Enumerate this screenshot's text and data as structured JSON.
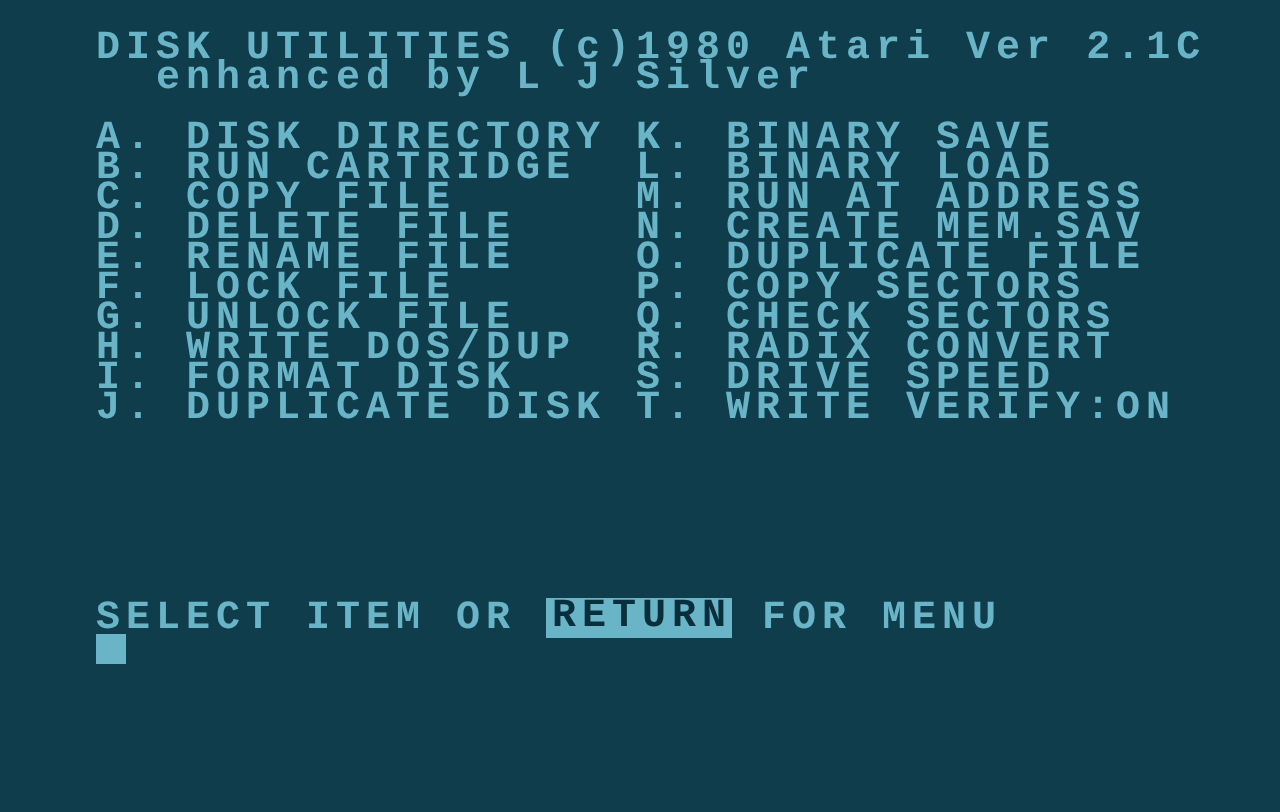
{
  "header": [
    "DISK UTILITIES (c)1980 Atari Ver 2.1C",
    "  enhanced by L J Silver"
  ],
  "menu_left": [
    "A. DISK DIRECTORY",
    "B. RUN CARTRIDGE",
    "C. COPY FILE",
    "D. DELETE FILE",
    "E. RENAME FILE",
    "F. LOCK FILE",
    "G. UNLOCK FILE",
    "H. WRITE DOS/DUP",
    "I. FORMAT DISK",
    "J. DUPLICATE DISK"
  ],
  "menu_right": [
    "K. BINARY SAVE",
    "L. BINARY LOAD",
    "M. RUN AT ADDRESS",
    "N. CREATE MEM.SAV",
    "O. DUPLICATE FILE",
    "P. COPY SECTORS",
    "Q. CHECK SECTORS",
    "R. RADIX CONVERT",
    "S. DRIVE SPEED",
    "T. WRITE VERIFY:ON"
  ],
  "prompt": {
    "before": "SELECT ITEM OR",
    "key": "RETURN",
    "after": "FOR MENU"
  }
}
